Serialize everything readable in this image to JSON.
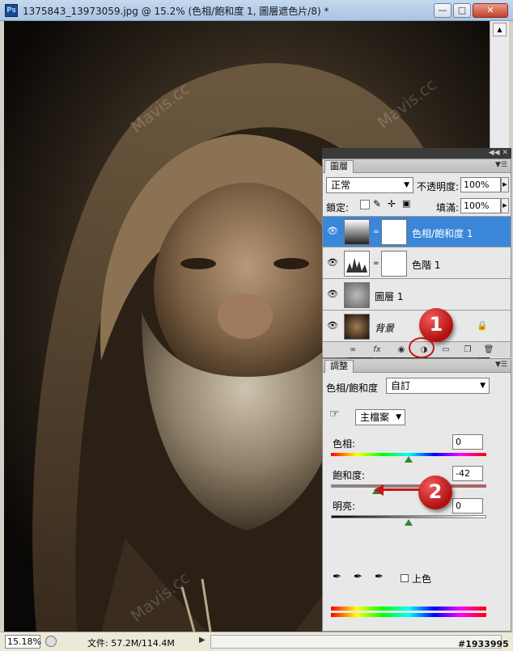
{
  "window": {
    "app_icon": "ps-icon",
    "app_icon_text": "Ps",
    "title": "1375843_13973059.jpg @ 15.2% (色相/飽和度 1, 圖層遮色片/8) *",
    "controls": [
      "minimize-icon",
      "restore-icon",
      "close-icon"
    ]
  },
  "watermark_text": "Mavis.cc",
  "credit": "#1933995",
  "layers_panel": {
    "tab": "圖層",
    "blend_mode": "正常",
    "opacity_label": "不透明度:",
    "opacity_value": "100%",
    "lock_label": "鎖定:",
    "fill_label": "填滿:",
    "fill_value": "100%",
    "layers": [
      {
        "name": "色相/飽和度 1",
        "active": true
      },
      {
        "name": "色階 1",
        "active": false
      },
      {
        "name": "圖層 1",
        "active": false
      },
      {
        "name": "背景",
        "active": false
      }
    ],
    "footer_icons": [
      "link-icon",
      "fx-icon",
      "mask-icon",
      "adjustment-icon",
      "group-icon",
      "new-layer-icon",
      "trash-icon"
    ]
  },
  "adjustments_panel": {
    "tab": "調整",
    "type_label": "色相/飽和度",
    "preset_value": "自訂",
    "channel_value": "主檔案",
    "hue_label": "色相:",
    "hue_value": "0",
    "saturation_label": "飽和度:",
    "saturation_value": "-42",
    "lightness_label": "明亮:",
    "lightness_value": "0",
    "colorize_label": "上色",
    "sliders": {
      "hue": 0,
      "saturation": -42,
      "lightness": 0
    }
  },
  "callouts": [
    "1",
    "2"
  ],
  "status": {
    "zoom": "15.18%",
    "doc": "文件: 57.2M/114.4M"
  },
  "colors": {
    "active_layer": "#3a86d9",
    "callout_red": "#c01818",
    "hue_slider_green": "#2a8a2a"
  }
}
